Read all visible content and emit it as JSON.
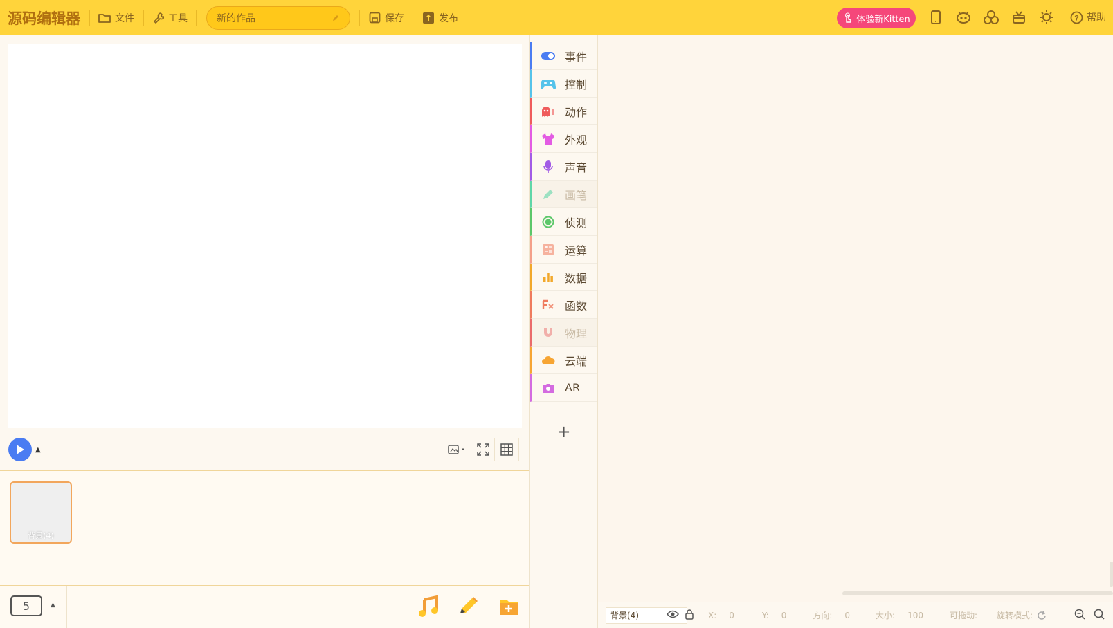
{
  "topbar": {
    "logo": "源码编辑器",
    "file_label": "文件",
    "tools_label": "工具",
    "project_title": "新的作品",
    "save_label": "保存",
    "publish_label": "发布",
    "kitten_button": "体验新Kitten",
    "help_label": "帮助",
    "icons": [
      "tablet-icon",
      "robot-icon",
      "extension-icon",
      "gift-box-icon",
      "settings-sun-icon"
    ]
  },
  "stage": {
    "run_button": "play-icon",
    "tools": [
      "screen-mode-icon",
      "fullscreen-icon",
      "grid-icon"
    ]
  },
  "sprites": [
    {
      "name": "背景(4)"
    }
  ],
  "bottom": {
    "scene_number": "5",
    "icons": [
      "music-icon",
      "paint-brush-icon",
      "add-folder-icon"
    ]
  },
  "categories": [
    {
      "label": "事件",
      "color": "#4a7cf2",
      "icon": "toggle-icon"
    },
    {
      "label": "控制",
      "color": "#56c3ea",
      "icon": "gamepad-icon"
    },
    {
      "label": "动作",
      "color": "#ef5b5b",
      "icon": "ghost-icon"
    },
    {
      "label": "外观",
      "color": "#e35be3",
      "icon": "shirt-icon"
    },
    {
      "label": "声音",
      "color": "#a25be6",
      "icon": "microphone-icon"
    },
    {
      "label": "画笔",
      "color": "#5fd6a8",
      "icon": "pen-icon",
      "disabled": true
    },
    {
      "label": "侦测",
      "color": "#5cc76a",
      "icon": "radar-icon"
    },
    {
      "label": "运算",
      "color": "#f4a08a",
      "icon": "calculator-icon"
    },
    {
      "label": "数据",
      "color": "#f2a82b",
      "icon": "bar-chart-icon"
    },
    {
      "label": "函数",
      "color": "#ef7b5e",
      "icon": "function-icon"
    },
    {
      "label": "物理",
      "color": "#ea6b6b",
      "icon": "magnet-icon",
      "disabled": true
    },
    {
      "label": "云端",
      "color": "#f7a533",
      "icon": "cloud-icon"
    },
    {
      "label": "AR",
      "color": "#d46be0",
      "icon": "camera-icon"
    }
  ],
  "add_category": "+",
  "status": {
    "object_name": "背景(4)",
    "x_label": "X:",
    "x_value": "0",
    "y_label": "Y:",
    "y_value": "0",
    "direction_label": "方向:",
    "direction_value": "0",
    "size_label": "大小:",
    "size_value": "100",
    "draggable_label": "可拖动:",
    "rotation_label": "旋转模式:"
  }
}
